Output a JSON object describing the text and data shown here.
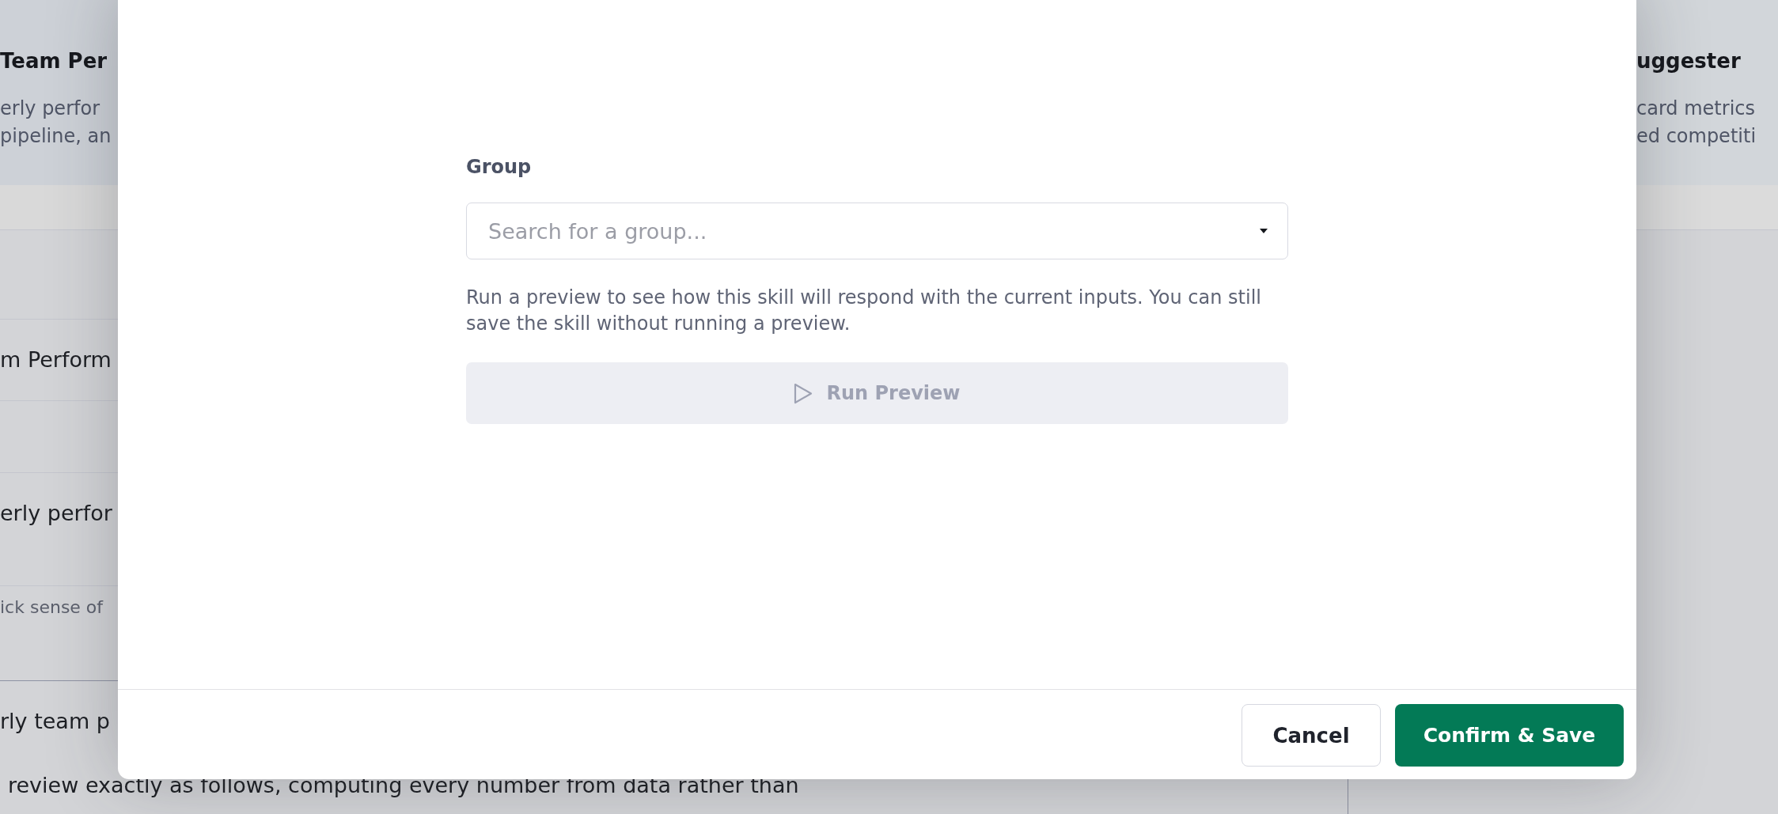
{
  "background": {
    "main": {
      "card": {
        "title": "Team Per",
        "description_lines": [
          "erly perfor",
          "pipeline, an"
        ]
      },
      "lines": [
        {
          "text": "m Perform",
          "kind": "value"
        },
        {
          "text": "erly perfor",
          "kind": "value"
        },
        {
          "text": "ick sense of",
          "kind": "hint"
        },
        {
          "text": "rly team p",
          "kind": "value"
        },
        {
          "text": "review exactly as follows, computing every number from data rather than",
          "kind": "value"
        }
      ]
    },
    "side": {
      "card": {
        "title": "uggester",
        "description_lines": [
          "card metrics",
          "ed competiti"
        ]
      }
    }
  },
  "dialog": {
    "field": {
      "label": "Group",
      "placeholder": "Search for a group..."
    },
    "help_text": "Run a preview to see how this skill will respond with the current inputs. You can still save the skill without running a preview.",
    "preview_button": {
      "label": "Run Preview",
      "disabled": true
    },
    "buttons": [
      {
        "label": "Cancel",
        "kind": "secondary"
      },
      {
        "label": "Confirm & Save",
        "kind": "primary"
      }
    ]
  }
}
